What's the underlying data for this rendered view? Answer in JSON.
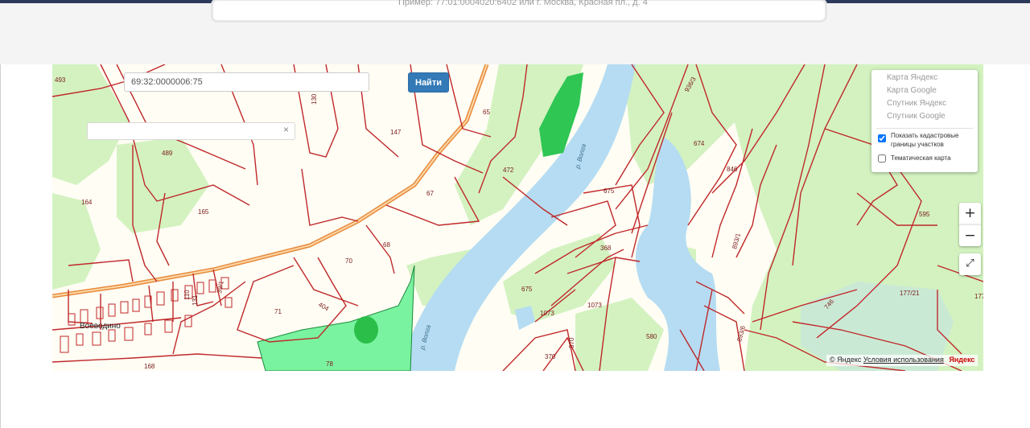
{
  "page": {
    "header_hint": "Пример: 77:01:0004020:6402 или г. Москва, Красная пл., д. 4"
  },
  "search": {
    "cadastral_value": "69:32:0000006:75",
    "find_label": "Найти",
    "address_value": "",
    "clear_glyph": "×"
  },
  "layers": {
    "items": [
      "Карта Яндекс",
      "Карта Google",
      "Спутник Яндекс",
      "Спутник Google"
    ],
    "show_cadastral_label_1": "Показать кадастровые",
    "show_cadastral_label_2": "границы участков",
    "show_cadastral_checked": true,
    "thematic_label": "Тематическая карта",
    "thematic_checked": false
  },
  "controls": {
    "zoom_in": "+",
    "zoom_out": "−",
    "fullscreen": "⤢"
  },
  "map": {
    "village_name": "Воеводино",
    "river_name": "р. Волга",
    "plot_numbers": [
      "493",
      "130",
      "147",
      "65",
      "472",
      "936/3",
      "674",
      "489",
      "67",
      "675",
      "846",
      "164",
      "165",
      "595",
      "68",
      "368",
      "893/1",
      "70",
      "110",
      "131",
      "39/1",
      "675",
      "1073",
      "1073",
      "177/21",
      "71",
      "404",
      "746",
      "580",
      "893/6",
      "78",
      "168",
      "370",
      "370",
      "177"
    ],
    "colors": {
      "background": "#fffdf4",
      "forest": "#d3f2c0",
      "water": "#b5dcf2",
      "cadastral_border": "#c0282a",
      "highlight_plot": "#7af3a0",
      "road": "#e88a3c"
    }
  },
  "footer": {
    "copyright": "© Яндекс",
    "terms": "Условия использования",
    "brand": "Яндекс"
  }
}
